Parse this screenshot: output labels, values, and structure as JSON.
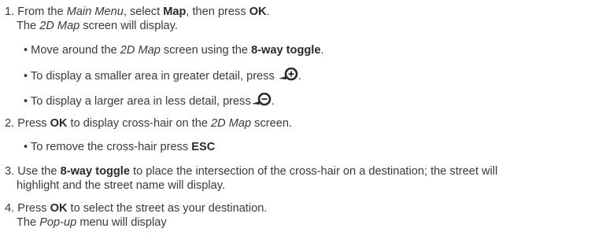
{
  "instructions": {
    "step1": {
      "num": "1.",
      "t1": "From the ",
      "main_menu": "Main Menu",
      "t2": ", select ",
      "map": "Map",
      "t3": ", then press ",
      "ok": "OK",
      "t4": "."
    },
    "step1_note": {
      "t1": "The ",
      "map2d": "2D Map",
      "t2": " screen will display."
    },
    "bullet1": {
      "t1": "• Move around the ",
      "map2d": "2D Map",
      "t2": " screen using the ",
      "toggle": "8-way toggle",
      "t3": "."
    },
    "bullet2": {
      "t1": "• To display a smaller area in greater detail, press ",
      "t2": "."
    },
    "bullet3": {
      "t1": "• To display a larger area in less detail, press",
      "t2": "."
    },
    "step2": {
      "num": "2.",
      "t1": "Press ",
      "ok": "OK",
      "t2": " to display cross-hair on the ",
      "map2d": "2D Map",
      "t3": " screen."
    },
    "bullet4": {
      "t1": "• To remove the cross-hair press ",
      "esc": "ESC"
    },
    "step3": {
      "num": "3.",
      "t1": "Use the ",
      "toggle": "8-way toggle",
      "t2": " to place the intersection of the cross-hair on a destination; the street will"
    },
    "step3_cont": "highlight and the street name will display.",
    "step4": {
      "num": "4.",
      "t1": "Press ",
      "ok": "OK",
      "t2": " to select the street as your destination."
    },
    "step4_note": {
      "t1": "The ",
      "popup": "Pop-up",
      "t2": " menu will display"
    },
    "icons": {
      "zoom_in": "zoom-in-icon",
      "zoom_out": "zoom-out-icon",
      "icon_color": "#2a2a2a"
    }
  }
}
